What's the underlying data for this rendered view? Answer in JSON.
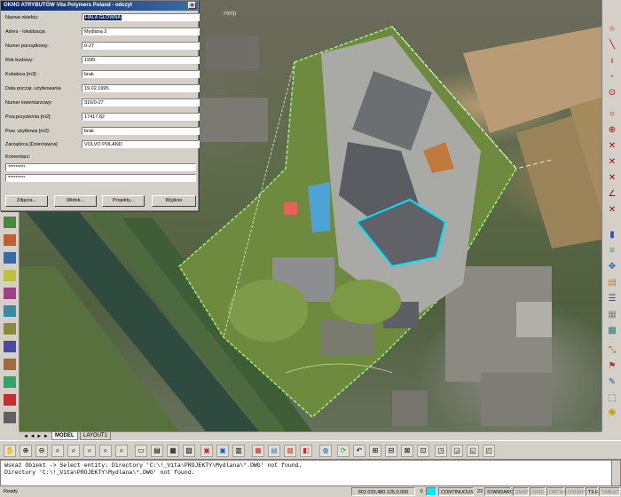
{
  "dialog": {
    "title": "OKNO ATRYBUTÓW Vita Polymers Poland - odczyt",
    "fields": [
      {
        "label": "Nazwa obiektu:",
        "value": "HALA GŁÓWNA"
      },
      {
        "label": "Adres - lokalizacja",
        "value": "Mydlana 2"
      },
      {
        "label": "Numer porządkowy:",
        "value": "0-27"
      },
      {
        "label": "Rok budowy:",
        "value": "1995"
      },
      {
        "label": "Kubatura        [m3] :",
        "value": "brak"
      },
      {
        "label": "Data począt. użytkowania",
        "value": "19.02.1995"
      },
      {
        "label": "Numer inwentarzowy:",
        "value": "316/0-27"
      },
      {
        "label": "Pow.przyziemia [m2]:",
        "value": "17417.82"
      },
      {
        "label": "Pow. użytkowa  [m2]:",
        "value": "brak"
      },
      {
        "label": "Zarządzca [Dzierżawca]",
        "value": "VOLVO POLAND"
      }
    ],
    "comment_label": "Komentarz:",
    "comment_line1": "*********",
    "comment_line2": "*********",
    "buttons": [
      "Zdjęcia...",
      "Widok...",
      "Projekty...",
      "Wyjście"
    ],
    "close_glyph": "×"
  },
  "map": {
    "help_label": "Help"
  },
  "tabs": {
    "nav": "◄ ◄ ► ►",
    "model": "MODEL",
    "layout": "LAYOUT1"
  },
  "command": {
    "line1": "Wskaż Obiekt ->  Select entity: Directory 'C:\\!_Vita\\PROJEKTY\\Mydlana\\*.DWG' not found.",
    "line2": "Directory 'C:\\!_Vita\\PROJEKTY\\Mydlana\\*.DWG' not found."
  },
  "status": {
    "ready": "Ready",
    "coords": "802.033,480.125,0.000",
    "layer_num": "0",
    "linetype": "CONTINUOUS",
    "lineweight_num": "23",
    "style": "STANDARD",
    "toggles": [
      "SNAP",
      "GRID",
      "ORTHO",
      "OSNAP",
      "TILE",
      "TABLET"
    ]
  },
  "colors": {
    "title_bar": "#0a246a",
    "highlight": "#00e5ff",
    "layer_swatch": "#00e5ff"
  },
  "icons": {
    "left": [
      "layers-icon",
      "polyline-icon",
      "arc-icon",
      "circle-icon",
      "rectangle-icon",
      "text-icon",
      "hatch-icon",
      "block-icon",
      "dimension-icon",
      "measure-icon",
      "print-icon",
      "exit-icon"
    ],
    "right": [
      "circle-icon",
      "line-icon",
      "point-icon",
      "node-icon",
      "ring-icon",
      "circle-icon",
      "target-icon",
      "cross-icon",
      "cross-icon",
      "cross-icon",
      "angle-icon",
      "cross-icon",
      "color-bar-icon",
      "layers-icon",
      "move-icon",
      "properties-icon",
      "list-icon",
      "stack-icon",
      "grid-icon",
      "scale-icon",
      "flag-icon",
      "pen-icon",
      "select-icon",
      "palette-icon",
      "lock-icon",
      "info-icon"
    ],
    "bottom": [
      "pan-icon",
      "zoom-in-icon",
      "zoom-out-icon",
      "zoom-window-icon",
      "zoom-all-icon",
      "zoom-prev-icon",
      "page-icon",
      "print-icon",
      "table-icon",
      "plot-icon",
      "photo-icon",
      "image-icon",
      "tab-icon",
      "globe-icon",
      "refresh-icon",
      "undo-icon",
      "tool-icon",
      "tool-icon",
      "tool-icon",
      "tool-icon",
      "tool-icon",
      "tool-icon",
      "tool-icon"
    ]
  }
}
